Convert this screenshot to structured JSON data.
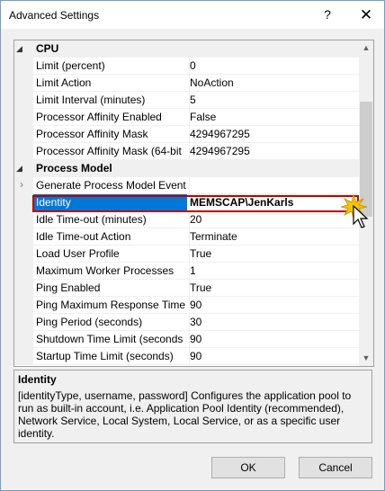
{
  "window": {
    "title": "Advanced Settings",
    "help_glyph": "?",
    "close_glyph": "✕"
  },
  "grid": {
    "sections": [
      {
        "category": "CPU",
        "rows": [
          {
            "name": "Limit (percent)",
            "value": "0"
          },
          {
            "name": "Limit Action",
            "value": "NoAction"
          },
          {
            "name": "Limit Interval (minutes)",
            "value": "5"
          },
          {
            "name": "Processor Affinity Enabled",
            "value": "False"
          },
          {
            "name": "Processor Affinity Mask",
            "value": "4294967295"
          },
          {
            "name": "Processor Affinity Mask (64-bit",
            "value": "4294967295"
          }
        ]
      },
      {
        "category": "Process Model",
        "rows": [
          {
            "name": "Generate Process Model Event L",
            "value": "",
            "expandable": true
          },
          {
            "name": "Identity",
            "value": "MEMSCAP\\JenKarls",
            "selected": true
          },
          {
            "name": "Idle Time-out (minutes)",
            "value": "20"
          },
          {
            "name": "Idle Time-out Action",
            "value": "Terminate"
          },
          {
            "name": "Load User Profile",
            "value": "True"
          },
          {
            "name": "Maximum Worker Processes",
            "value": "1"
          },
          {
            "name": "Ping Enabled",
            "value": "True"
          },
          {
            "name": "Ping Maximum Response Time",
            "value": "90"
          },
          {
            "name": "Ping Period (seconds)",
            "value": "30"
          },
          {
            "name": "Shutdown Time Limit (seconds",
            "value": "90"
          },
          {
            "name": "Startup Time Limit (seconds)",
            "value": "90"
          }
        ]
      }
    ],
    "category_glyph": "◢",
    "expand_glyph": "›",
    "scroll_up_glyph": "▲",
    "scroll_down_glyph": "▼"
  },
  "description": {
    "title": "Identity",
    "text": "[identityType, username, password] Configures the application pool to run as built-in account, i.e. Application Pool Identity (recommended), Network Service, Local System, Local Service, or as a specific user identity."
  },
  "buttons": {
    "ok": "OK",
    "cancel": "Cancel"
  },
  "colors": {
    "selection": "#0078d7",
    "highlight_border": "#c00000",
    "cursor_burst": "#f5c400"
  }
}
